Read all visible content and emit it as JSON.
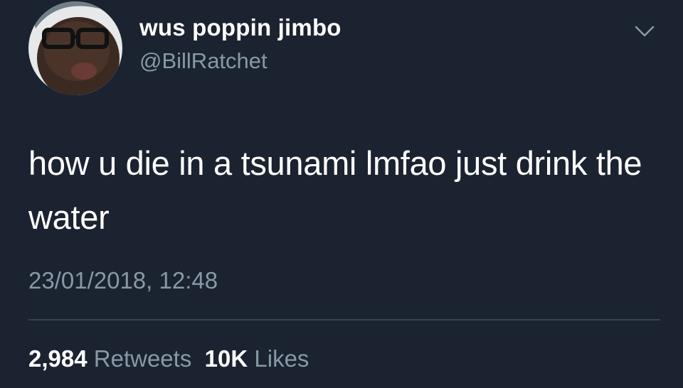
{
  "user": {
    "display_name": "wus poppin jimbo",
    "handle": "@BillRatchet"
  },
  "tweet": {
    "text": "how u die in a tsunami lmfao just drink the water",
    "timestamp": "23/01/2018, 12:48"
  },
  "stats": {
    "retweets_count": "2,984",
    "retweets_label": "Retweets",
    "likes_count": "10K",
    "likes_label": "Likes"
  },
  "icons": {
    "menu": "chevron-down-icon"
  },
  "colors": {
    "background": "#1b2330",
    "text": "#ffffff",
    "muted": "#8899a6",
    "divider": "#38444d"
  }
}
